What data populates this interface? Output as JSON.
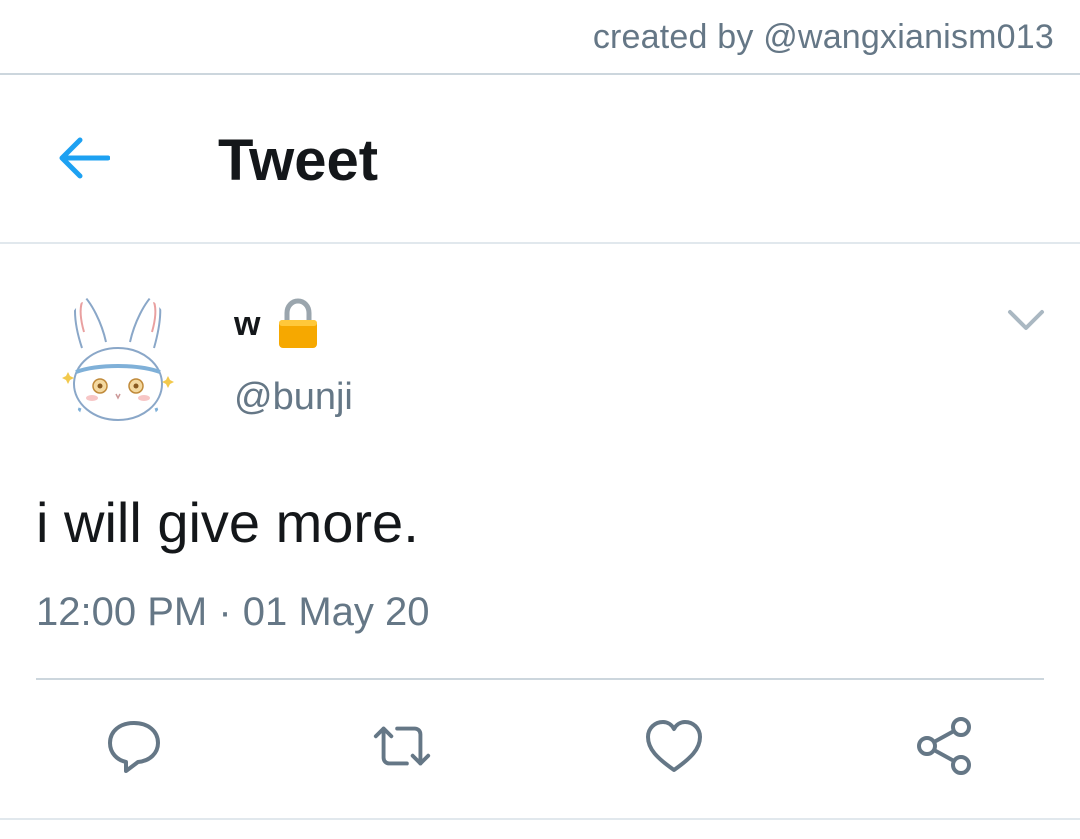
{
  "credit": "created by @wangxianism013",
  "header": {
    "title": "Tweet",
    "back_icon": "back-arrow-icon"
  },
  "tweet": {
    "display_name": "w",
    "handle": "@bunji",
    "text": "i will give more.",
    "timestamp": "12:00 PM · 01 May 20",
    "avatar": "bunny-avatar",
    "protected_icon": "lock-icon",
    "menu_icon": "chevron-down-icon"
  },
  "actions": [
    {
      "name": "reply",
      "icon": "reply-icon"
    },
    {
      "name": "retweet",
      "icon": "retweet-icon"
    },
    {
      "name": "like",
      "icon": "heart-icon"
    },
    {
      "name": "share",
      "icon": "share-icon"
    }
  ],
  "colors": {
    "accent": "#1da1f2",
    "text": "#14171a",
    "secondary": "#657786",
    "divider": "#ccd6dd",
    "lock": "#f6a800"
  }
}
